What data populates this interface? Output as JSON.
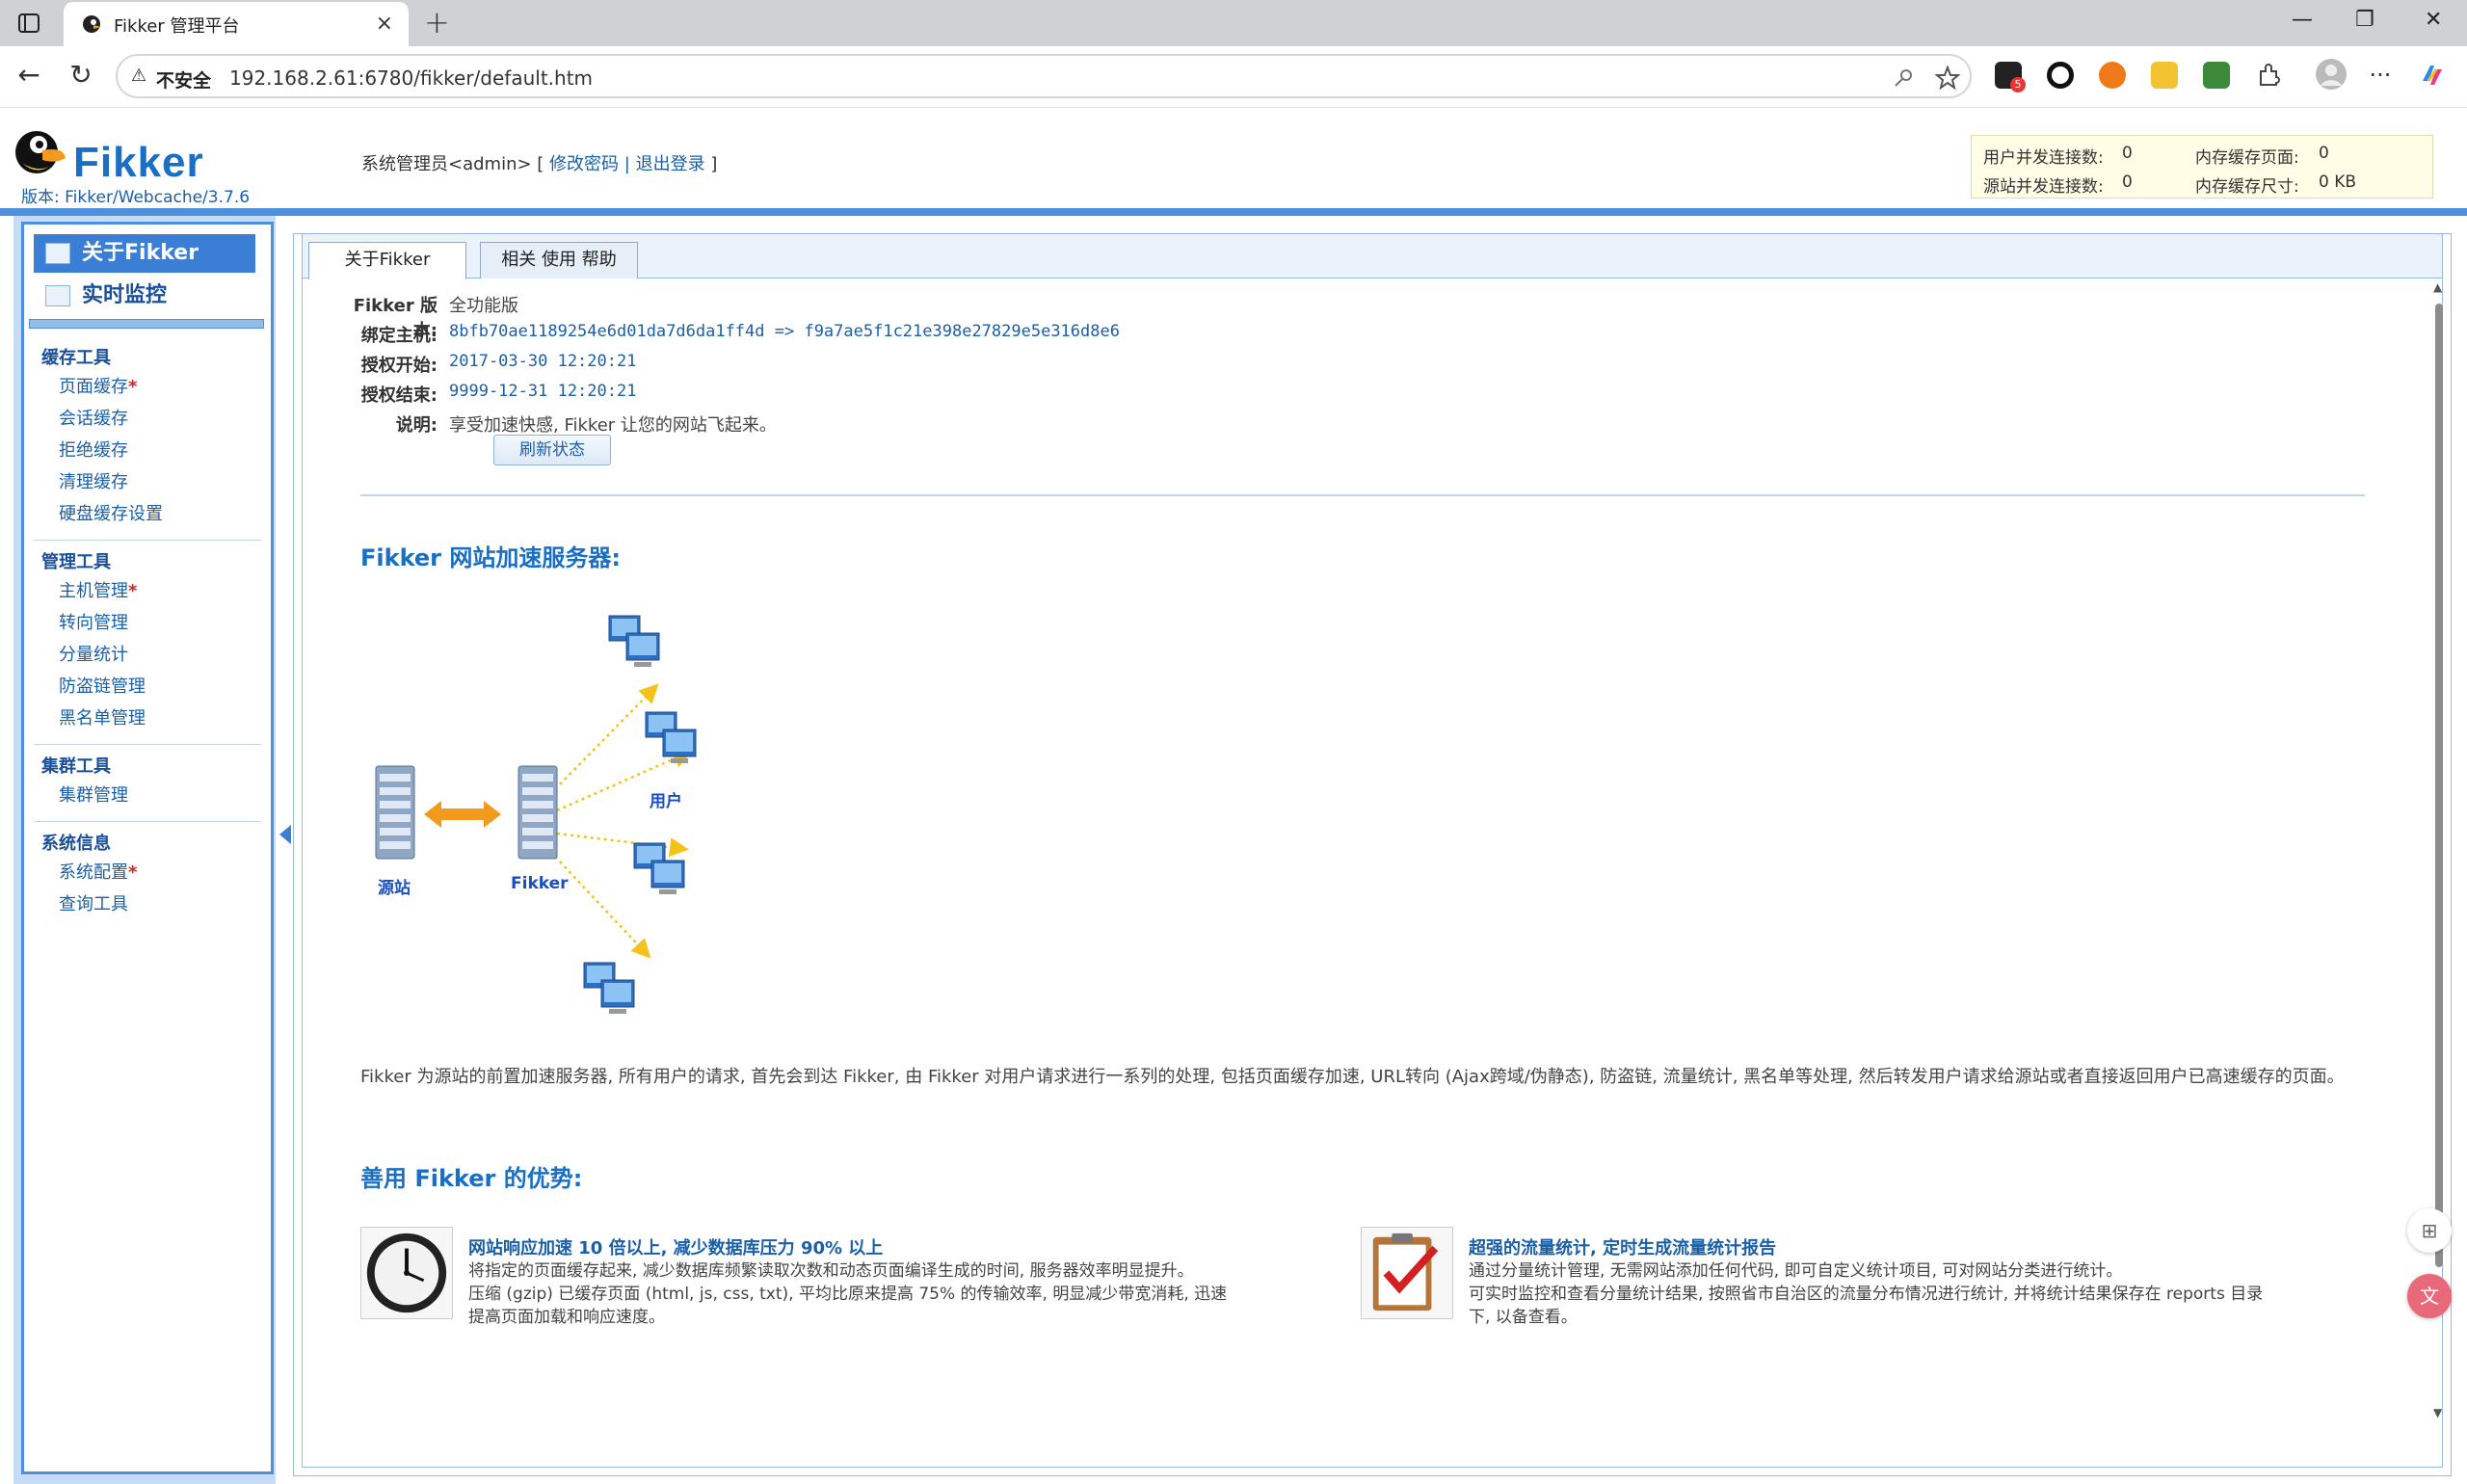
{
  "browser": {
    "tab_title": "Fikker 管理平台",
    "tab_close": "×",
    "new_tab": "+",
    "security_label": "不安全",
    "url": "192.168.2.61:6780/fikker/default.htm",
    "window_minimize": "—",
    "window_restore": "❐",
    "window_close": "✕",
    "more_menu": "···",
    "back": "←",
    "reload": "↻"
  },
  "header": {
    "logo_text": "Fikker",
    "version": "版本: Fikker/Webcache/3.7.6",
    "user_prefix": "系统管理员<admin> [",
    "change_password": "修改密码",
    "separator": "|",
    "logout": "退出登录",
    "user_suffix": "]"
  },
  "stats": {
    "user_conn_label": "用户并发连接数:",
    "user_conn_value": "0",
    "mem_pages_label": "内存缓存页面:",
    "mem_pages_value": "0",
    "origin_conn_label": "源站并发连接数:",
    "origin_conn_value": "0",
    "mem_size_label": "内存缓存尺寸:",
    "mem_size_value": "0 KB"
  },
  "sidebar": {
    "top_items": [
      {
        "label": "关于Fikker",
        "active": true
      },
      {
        "label": "实时监控",
        "active": false
      }
    ],
    "groups": [
      {
        "title": "缓存工具",
        "items": [
          {
            "label": "页面缓存",
            "star": "*"
          },
          {
            "label": "会话缓存",
            "star": ""
          },
          {
            "label": "拒绝缓存",
            "star": ""
          },
          {
            "label": "清理缓存",
            "star": ""
          },
          {
            "label": "硬盘缓存设置",
            "star": ""
          }
        ]
      },
      {
        "title": "管理工具",
        "items": [
          {
            "label": "主机管理",
            "star": "*"
          },
          {
            "label": "转向管理",
            "star": ""
          },
          {
            "label": "分量统计",
            "star": ""
          },
          {
            "label": "防盗链管理",
            "star": ""
          },
          {
            "label": "黑名单管理",
            "star": ""
          }
        ]
      },
      {
        "title": "集群工具",
        "items": [
          {
            "label": "集群管理",
            "star": ""
          }
        ]
      },
      {
        "title": "系统信息",
        "items": [
          {
            "label": "系统配置",
            "star": "*"
          },
          {
            "label": "查询工具",
            "star": ""
          }
        ]
      }
    ]
  },
  "main": {
    "tabs": [
      {
        "label": "关于Fikker",
        "active": true
      },
      {
        "label": "相关 使用 帮助",
        "active": false
      }
    ],
    "info": [
      {
        "key": "Fikker 版本:",
        "value": "全功能版",
        "style": "plain"
      },
      {
        "key": "绑定主机:",
        "value": "8bfb70ae1189254e6d01da7d6da1ff4d => f9a7ae5f1c21e398e27829e5e316d8e6",
        "style": "mono"
      },
      {
        "key": "授权开始:",
        "value": "2017-03-30 12:20:21",
        "style": "mono"
      },
      {
        "key": "授权结束:",
        "value": "9999-12-31 12:20:21",
        "style": "mono"
      },
      {
        "key": "说明:",
        "value": "享受加速快感, Fikker 让您的网站飞起来。",
        "style": "plain"
      }
    ],
    "refresh_button": "刷新状态",
    "section1_title": "Fikker 网站加速服务器:",
    "diagram": {
      "origin_label": "源站",
      "fikker_label": "Fikker",
      "users_label": "用户"
    },
    "description": "Fikker 为源站的前置加速服务器, 所有用户的请求, 首先会到达 Fikker, 由 Fikker 对用户请求进行一系列的处理, 包括页面缓存加速, URL转向 (Ajax跨域/伪静态), 防盗链, 流量统计, 黑名单等处理, 然后转发用户请求给源站或者直接返回用户已高速缓存的页面。",
    "section2_title": "善用 Fikker 的优势:",
    "advantages": [
      {
        "icon": "clock-icon",
        "title": "网站响应加速 10 倍以上, 减少数据库压力 90% 以上",
        "lines": [
          "将指定的页面缓存起来, 减少数据库频繁读取次数和动态页面编译生成的时间, 服务器效率明显提升。",
          "压缩 (gzip) 已缓存页面 (html, js, css, txt), 平均比原来提高 75% 的传输效率, 明显减少带宽消耗, 迅速",
          "提高页面加载和响应速度。"
        ]
      },
      {
        "icon": "checklist-icon",
        "title": "超强的流量统计, 定时生成流量统计报告",
        "lines": [
          "通过分量统计管理, 无需网站添加任何代码, 即可自定义统计项目, 可对网站分类进行统计。",
          "可实时监控和查看分量统计结果, 按照省市自治区的流量分布情况进行统计, 并将统计结果保存在 reports 目录",
          "下, 以备查看。"
        ]
      }
    ]
  },
  "colors": {
    "accent": "#3a7fd5",
    "link": "#1a5fa8",
    "star": "#e01e1e",
    "arrow_orange": "#f39a1e",
    "arrow_yellow": "#f6c21a"
  }
}
